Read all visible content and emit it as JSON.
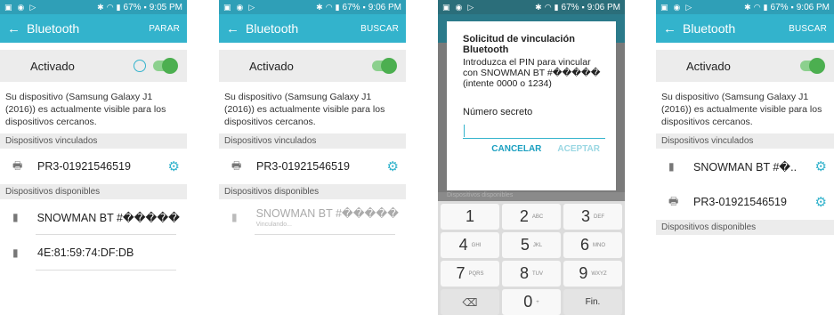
{
  "status": {
    "battery": "67%",
    "times": [
      "9:05 PM",
      "9:06 PM",
      "9:06 PM",
      "9:06 PM"
    ]
  },
  "icons": {
    "back": "arrow-left-icon",
    "gear": "gear-icon",
    "laptop": "laptop-icon",
    "phone": "phone-icon"
  },
  "colors": {
    "accent": "#33b3cc",
    "switch": "#4caf50"
  },
  "screens": {
    "s1": {
      "title": "Bluetooth",
      "action": "PARAR",
      "toggle_label": "Activado",
      "description": "Su dispositivo (Samsung Galaxy J1 (2016)) es actualmente visible para los dispositivos cercanos.",
      "paired_header": "Dispositivos vinculados",
      "paired": [
        "PR3-01921546519"
      ],
      "available_header": "Dispositivos disponibles",
      "available": [
        "SNOWMAN BT #�����",
        "4E:81:59:74:DF:DB"
      ]
    },
    "s2": {
      "title": "Bluetooth",
      "action": "BUSCAR",
      "toggle_label": "Activado",
      "description": "Su dispositivo (Samsung Galaxy J1 (2016)) es actualmente visible para los dispositivos cercanos.",
      "paired_header": "Dispositivos vinculados",
      "paired": [
        "PR3-01921546519"
      ],
      "available_header": "Dispositivos disponibles",
      "available": [
        "SNOWMAN BT #�����"
      ],
      "pairing_status": "Vinculando..."
    },
    "s3": {
      "dialog_title": "Solicitud de vinculación Bluetooth",
      "dialog_body": "Introduzca el PIN para vincular con SNOWMAN BT #����� (intente 0000 o 1234)",
      "field_label": "Número secreto",
      "cancel": "CANCELAR",
      "accept": "ACEPTAR",
      "peek": "Dispositivos disponibles",
      "keys": [
        {
          "num": "1",
          "sub": ""
        },
        {
          "num": "2",
          "sub": "ABC"
        },
        {
          "num": "3",
          "sub": "DEF"
        },
        {
          "num": "4",
          "sub": "GHI"
        },
        {
          "num": "5",
          "sub": "JKL"
        },
        {
          "num": "6",
          "sub": "MNO"
        },
        {
          "num": "7",
          "sub": "PQRS"
        },
        {
          "num": "8",
          "sub": "TUV"
        },
        {
          "num": "9",
          "sub": "WXYZ"
        }
      ],
      "zero": "0",
      "zero_sub": "+",
      "done": "Fin."
    },
    "s4": {
      "title": "Bluetooth",
      "action": "BUSCAR",
      "toggle_label": "Activado",
      "description": "Su dispositivo (Samsung Galaxy J1 (2016)) es actualmente visible para los dispositivos cercanos.",
      "paired_header": "Dispositivos vinculados",
      "paired": [
        "SNOWMAN BT #�..",
        "PR3-01921546519"
      ],
      "available_header": "Dispositivos disponibles"
    }
  }
}
